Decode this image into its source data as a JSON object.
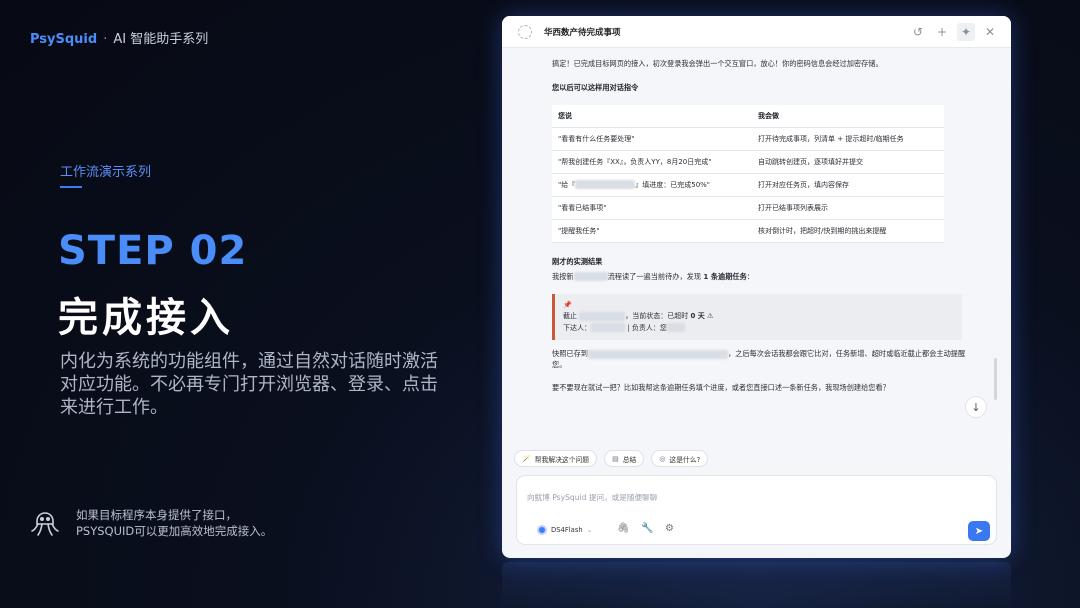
{
  "brand": {
    "name": "PsySquid",
    "dot": "·",
    "subtitle": "AI 智能助手系列"
  },
  "slide": {
    "series": "工作流演示系列",
    "step": "STEP 02",
    "title": "完成接入",
    "description": "内化为系统的功能组件，通过自然对话随时激活对应功能。不必再专门打开浏览器、登录、点击来进行工作。",
    "note_line1": "如果目标程序本身提供了接口，",
    "note_line2": "PSYSQUID可以更加高效地完成接入。"
  },
  "window": {
    "title": "华西数产待完成事项",
    "icons": [
      "history-icon",
      "plus-icon",
      "pin-icon",
      "close-icon"
    ]
  },
  "chat": {
    "intro": "搞定！已完成目标网页的接入，初次登录我会弹出一个交互窗口，放心！你的密码信息会经过加密存储。",
    "commands_heading": "您以后可以这样用对话指令",
    "table_headers": {
      "you_say": "您说",
      "i_do": "我会做"
    },
    "rows": [
      {
        "say": "\"看看有什么任务要处理\"",
        "do": "打开待完成事项，列清单 + 提示超时/临期任务"
      },
      {
        "say": "\"帮我创建任务『XX』，负责人YY，8月20日完成\"",
        "do": "自动跳转创建页，逐项填好并提交"
      },
      {
        "say_prefix": "\"给『",
        "say_suffix": "』填进度：已完成50%\"",
        "do": "打开对应任务页，填内容保存"
      },
      {
        "say": "\"看看已结事项\"",
        "do": "打开已结事项列表展示"
      },
      {
        "say": "\"提醒我任务\"",
        "do": "核对倒计时，把超时/快到期的挑出来提醒"
      }
    ],
    "result_heading": "刚才的实测结果",
    "result_prefix": "我按新",
    "result_mid": "流程读了一遍当前待办，发现 ",
    "result_bold": "1 条逾期任务",
    "result_suffix": "：",
    "card_pin": "📌",
    "card_line2_prefix": "截止",
    "card_line2_mid": "，当前状态：已超时",
    "card_line2_bold": "0 天",
    "card_line2_warn": "⚠",
    "card_line3_prefix": "下达人：",
    "card_line3_mid": "| 负责人：您",
    "snapshot_prefix": "快照已存到",
    "snapshot_suffix": "，之后每次会话我都会跟它比对，任务新增、超时或临近截止都会主动提醒您。",
    "question": "要不要现在就试一把？比如我帮这条逾期任务填个进度，或者您直接口述一条新任务，我现场创建给您看？"
  },
  "quick_actions": [
    {
      "icon": "🪄",
      "label": "帮我解决这个问题"
    },
    {
      "icon": "▤",
      "label": "总结"
    },
    {
      "icon": "◎",
      "label": "这是什么?"
    }
  ],
  "composer": {
    "placeholder": "向鱿博 PsySquid 提问，或是随便聊聊",
    "model": "DS4Flash",
    "send_icon": "➤"
  },
  "colors": {
    "accent": "#4b8df8",
    "background": "#070a14",
    "send": "#3a78f2",
    "warning_bar": "#c65a3a"
  }
}
